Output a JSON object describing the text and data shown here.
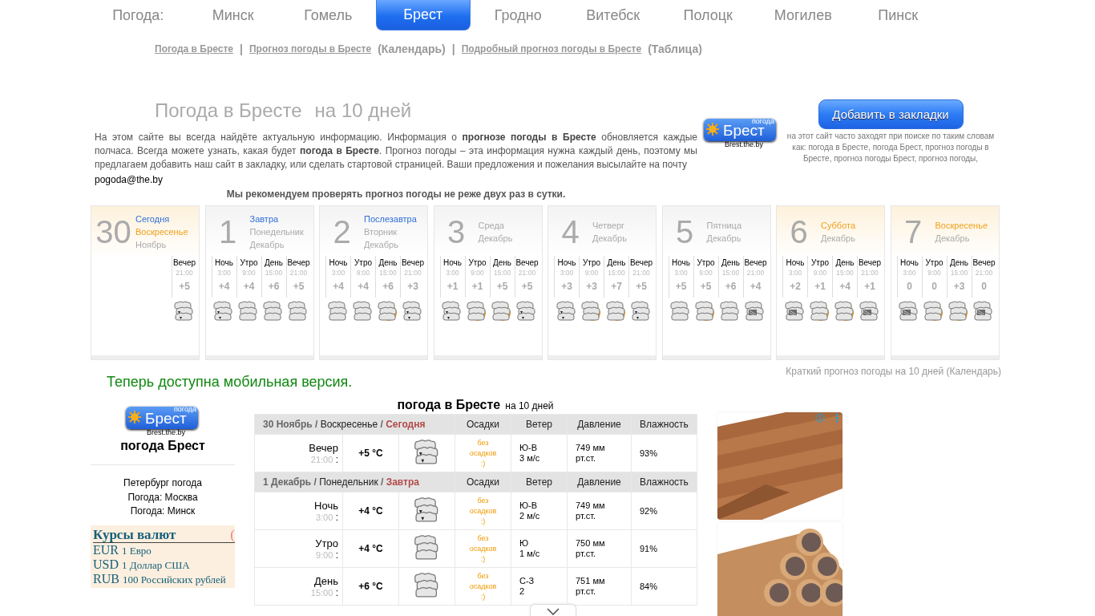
{
  "nav": {
    "label": "Погода:",
    "items": [
      {
        "label": "Минск",
        "selected": false
      },
      {
        "label": "Гомель",
        "selected": false
      },
      {
        "label": "Брест",
        "selected": true
      },
      {
        "label": "Гродно",
        "selected": false
      },
      {
        "label": "Витебск",
        "selected": false
      },
      {
        "label": "Полоцк",
        "selected": false
      },
      {
        "label": "Могилев",
        "selected": false
      },
      {
        "label": "Пинск",
        "selected": false
      }
    ]
  },
  "links": [
    {
      "text": "Погода в Бресте",
      "kind": "link"
    },
    {
      "text": "|",
      "kind": "sep"
    },
    {
      "text": "Прогноз погоды в Бресте",
      "kind": "link"
    },
    {
      "text": "(Календарь)",
      "kind": "note"
    },
    {
      "text": "|",
      "kind": "sep"
    },
    {
      "text": "Подробный прогноз погоды в Бресте",
      "kind": "link"
    },
    {
      "text": "(Таблица)",
      "kind": "note"
    }
  ],
  "heading": {
    "title": "Погода в Бресте",
    "subtitle": "на 10 дней"
  },
  "intro": {
    "text": "На этом сайте вы всегда найдёте актуальную информацию. Информация о **прогнозе погоды в Бресте** обновляется каждые полчаса. Всегда можете узнать, какая будет **погода в Бресте**. Прогноз погоды – эта информация нужна каждый день, поэтому мы предлагаем добавить наш сайт в закладку, или сделать стартовой страницей. Ваши предложения и пожелания высылайте на почту",
    "email": "pogoda@the.by",
    "recommendation": "Мы рекомендуем проверять прогноз погоды не реже двух раз в сутки."
  },
  "logos": [
    {
      "small": "погода",
      "name": "Брест",
      "domain": "Brest.the.by"
    },
    {
      "small": "погода",
      "name": "Брест",
      "domain": "Brest.the.by"
    }
  ],
  "bookmark": {
    "button": "Добавить в закладки",
    "note": "на этот сайт часто заходят при поиске по таким словам как: погода в Бресте, погода Брест, прогноз погоды в Бресте, прогноз погоды Брест, прогноз погоды,"
  },
  "cards": [
    {
      "day": "30",
      "highlighted": true,
      "labels": [
        {
          "text": "Сегодня",
          "color": "#2f6fd8"
        },
        {
          "text": "Воскресенье",
          "color": "#f0a01c"
        },
        {
          "text": "Ноябрь",
          "color": "#aaaaaa"
        }
      ],
      "periods": [
        {
          "name": "Вечер",
          "time": "21:00",
          "temp": "+5",
          "kind": "rain"
        }
      ]
    },
    {
      "day": "1",
      "highlighted": false,
      "labels": [
        {
          "text": "Завтра",
          "color": "#2f6fd8"
        },
        {
          "text": "Понедельник",
          "color": "#aaaaaa"
        },
        {
          "text": "Декабрь",
          "color": "#aaaaaa"
        }
      ],
      "periods": [
        {
          "name": "Ночь",
          "time": "3:00",
          "temp": "+4",
          "kind": "rain"
        },
        {
          "name": "Утро",
          "time": "9:00",
          "temp": "+4",
          "kind": "cloudy"
        },
        {
          "name": "День",
          "time": "15:00",
          "temp": "+6",
          "kind": "cloudy"
        },
        {
          "name": "Вечер",
          "time": "21:00",
          "temp": "+5",
          "kind": "cloudy"
        }
      ]
    },
    {
      "day": "2",
      "highlighted": false,
      "labels": [
        {
          "text": "Послезавтра",
          "color": "#2f6fd8"
        },
        {
          "text": "Вторник",
          "color": "#aaaaaa"
        },
        {
          "text": "Декабрь",
          "color": "#aaaaaa"
        }
      ],
      "periods": [
        {
          "name": "Ночь",
          "time": "3:00",
          "temp": "+4",
          "kind": "cloudy"
        },
        {
          "name": "Утро",
          "time": "9:00",
          "temp": "+4",
          "kind": "cloudy"
        },
        {
          "name": "День",
          "time": "15:00",
          "temp": "+6",
          "kind": "sun"
        },
        {
          "name": "Вечер",
          "time": "21:00",
          "temp": "+3",
          "kind": "rain"
        }
      ]
    },
    {
      "day": "3",
      "highlighted": false,
      "labels": [
        {
          "text": "Среда",
          "color": "#aaaaaa"
        },
        {
          "text": "Декабрь",
          "color": "#aaaaaa"
        }
      ],
      "periods": [
        {
          "name": "Ночь",
          "time": "3:00",
          "temp": "+1",
          "kind": "rain"
        },
        {
          "name": "Утро",
          "time": "9:00",
          "temp": "+1",
          "kind": "sun"
        },
        {
          "name": "День",
          "time": "15:00",
          "temp": "+5",
          "kind": "sun"
        },
        {
          "name": "Вечер",
          "time": "21:00",
          "temp": "+5",
          "kind": "rain"
        }
      ]
    },
    {
      "day": "4",
      "highlighted": false,
      "labels": [
        {
          "text": "Четверг",
          "color": "#aaaaaa"
        },
        {
          "text": "Декабрь",
          "color": "#aaaaaa"
        }
      ],
      "periods": [
        {
          "name": "Ночь",
          "time": "3:00",
          "temp": "+3",
          "kind": "rain"
        },
        {
          "name": "Утро",
          "time": "9:00",
          "temp": "+3",
          "kind": "sun"
        },
        {
          "name": "День",
          "time": "15:00",
          "temp": "+7",
          "kind": "sun"
        },
        {
          "name": "Вечер",
          "time": "21:00",
          "temp": "+5",
          "kind": "rain"
        }
      ]
    },
    {
      "day": "5",
      "highlighted": false,
      "labels": [
        {
          "text": "Пятница",
          "color": "#aaaaaa"
        },
        {
          "text": "Декабрь",
          "color": "#aaaaaa"
        }
      ],
      "periods": [
        {
          "name": "Ночь",
          "time": "3:00",
          "temp": "+5",
          "kind": "cloudy"
        },
        {
          "name": "Утро",
          "time": "9:00",
          "temp": "+5",
          "kind": "sun"
        },
        {
          "name": "День",
          "time": "15:00",
          "temp": "+6",
          "kind": "cloudy"
        },
        {
          "name": "Вечер",
          "time": "21:00",
          "temp": "+4",
          "kind": "snow"
        }
      ]
    },
    {
      "day": "6",
      "highlighted": true,
      "labels": [
        {
          "text": "Суббота",
          "color": "#f0a01c"
        },
        {
          "text": "Декабрь",
          "color": "#aaaaaa"
        }
      ],
      "periods": [
        {
          "name": "Ночь",
          "time": "3:00",
          "temp": "+2",
          "kind": "snow"
        },
        {
          "name": "Утро",
          "time": "9:00",
          "temp": "+1",
          "kind": "sun"
        },
        {
          "name": "День",
          "time": "15:00",
          "temp": "+4",
          "kind": "sun"
        },
        {
          "name": "Вечер",
          "time": "21:00",
          "temp": "+1",
          "kind": "snow"
        }
      ]
    },
    {
      "day": "7",
      "highlighted": true,
      "labels": [
        {
          "text": "Воскресенье",
          "color": "#f0a01c"
        },
        {
          "text": "Декабрь",
          "color": "#aaaaaa"
        }
      ],
      "periods": [
        {
          "name": "Ночь",
          "time": "3:00",
          "temp": "0",
          "kind": "snow"
        },
        {
          "name": "Утро",
          "time": "9:00",
          "temp": "0",
          "kind": "sun"
        },
        {
          "name": "День",
          "time": "15:00",
          "temp": "+3",
          "kind": "sun"
        },
        {
          "name": "Вечер",
          "time": "21:00",
          "temp": "0",
          "kind": "snow"
        }
      ]
    }
  ],
  "mobile_note": "Теперь доступна мобильная версия.",
  "calendar_link": "Краткий прогноз погоды на 10 дней (Календарь)",
  "sidebar": {
    "title": "погода Брест",
    "links": [
      "Петербург погода",
      "Погода: Москва",
      "Погода: Минск"
    ],
    "currency": {
      "title": "Курсы валют",
      "corner": "(",
      "rates": [
        {
          "code": "EUR",
          "name": "1 Евро"
        },
        {
          "code": "USD",
          "name": "1 Доллар США"
        },
        {
          "code": "RUB",
          "name": "100 Российских рублей"
        }
      ]
    }
  },
  "table": {
    "title": "погода в Бресте",
    "subtitle": "на 10 дней",
    "days": [
      {
        "date": "30 Ноябрь /",
        "weekday": "Воскресенье",
        "slash": "/",
        "relative": "Сегодня",
        "columns": [
          "Осадки",
          "Ветер",
          "Давление",
          "Влажность"
        ],
        "rows": [
          {
            "period": "Вечер",
            "time": "21:00",
            "sep": ":",
            "temp": "+5 °C",
            "kind": "rain",
            "precip": "без осадков :)",
            "wind_dir": "Ю-В",
            "wind_speed": "3 м/с",
            "pressure": "749 мм рт.ст.",
            "humidity": "93%"
          }
        ]
      },
      {
        "date": "1 Декабрь /",
        "weekday": "Понедельник",
        "slash": "/",
        "relative": "Завтра",
        "columns": [
          "Осадки",
          "Ветер",
          "Давление",
          "Влажность"
        ],
        "rows": [
          {
            "period": "Ночь",
            "time": "3:00",
            "sep": ":",
            "temp": "+4 °C",
            "kind": "rain",
            "precip": "без осадков :)",
            "wind_dir": "Ю-В",
            "wind_speed": "2 м/с",
            "pressure": "749 мм рт.ст.",
            "humidity": "92%"
          },
          {
            "period": "Утро",
            "time": "9:00",
            "sep": ":",
            "temp": "+4 °C",
            "kind": "cloudy",
            "precip": "без осадков :)",
            "wind_dir": "Ю",
            "wind_speed": "1 м/с",
            "pressure": "750 мм рт.ст.",
            "humidity": "91%"
          },
          {
            "period": "День",
            "time": "15:00",
            "sep": ":",
            "temp": "+6 °C",
            "kind": "cloudy",
            "precip": "без осадков :)",
            "wind_dir": "С-З",
            "wind_speed": "2",
            "pressure": "751 мм рт.ст.",
            "humidity": "84%"
          }
        ]
      }
    ]
  }
}
